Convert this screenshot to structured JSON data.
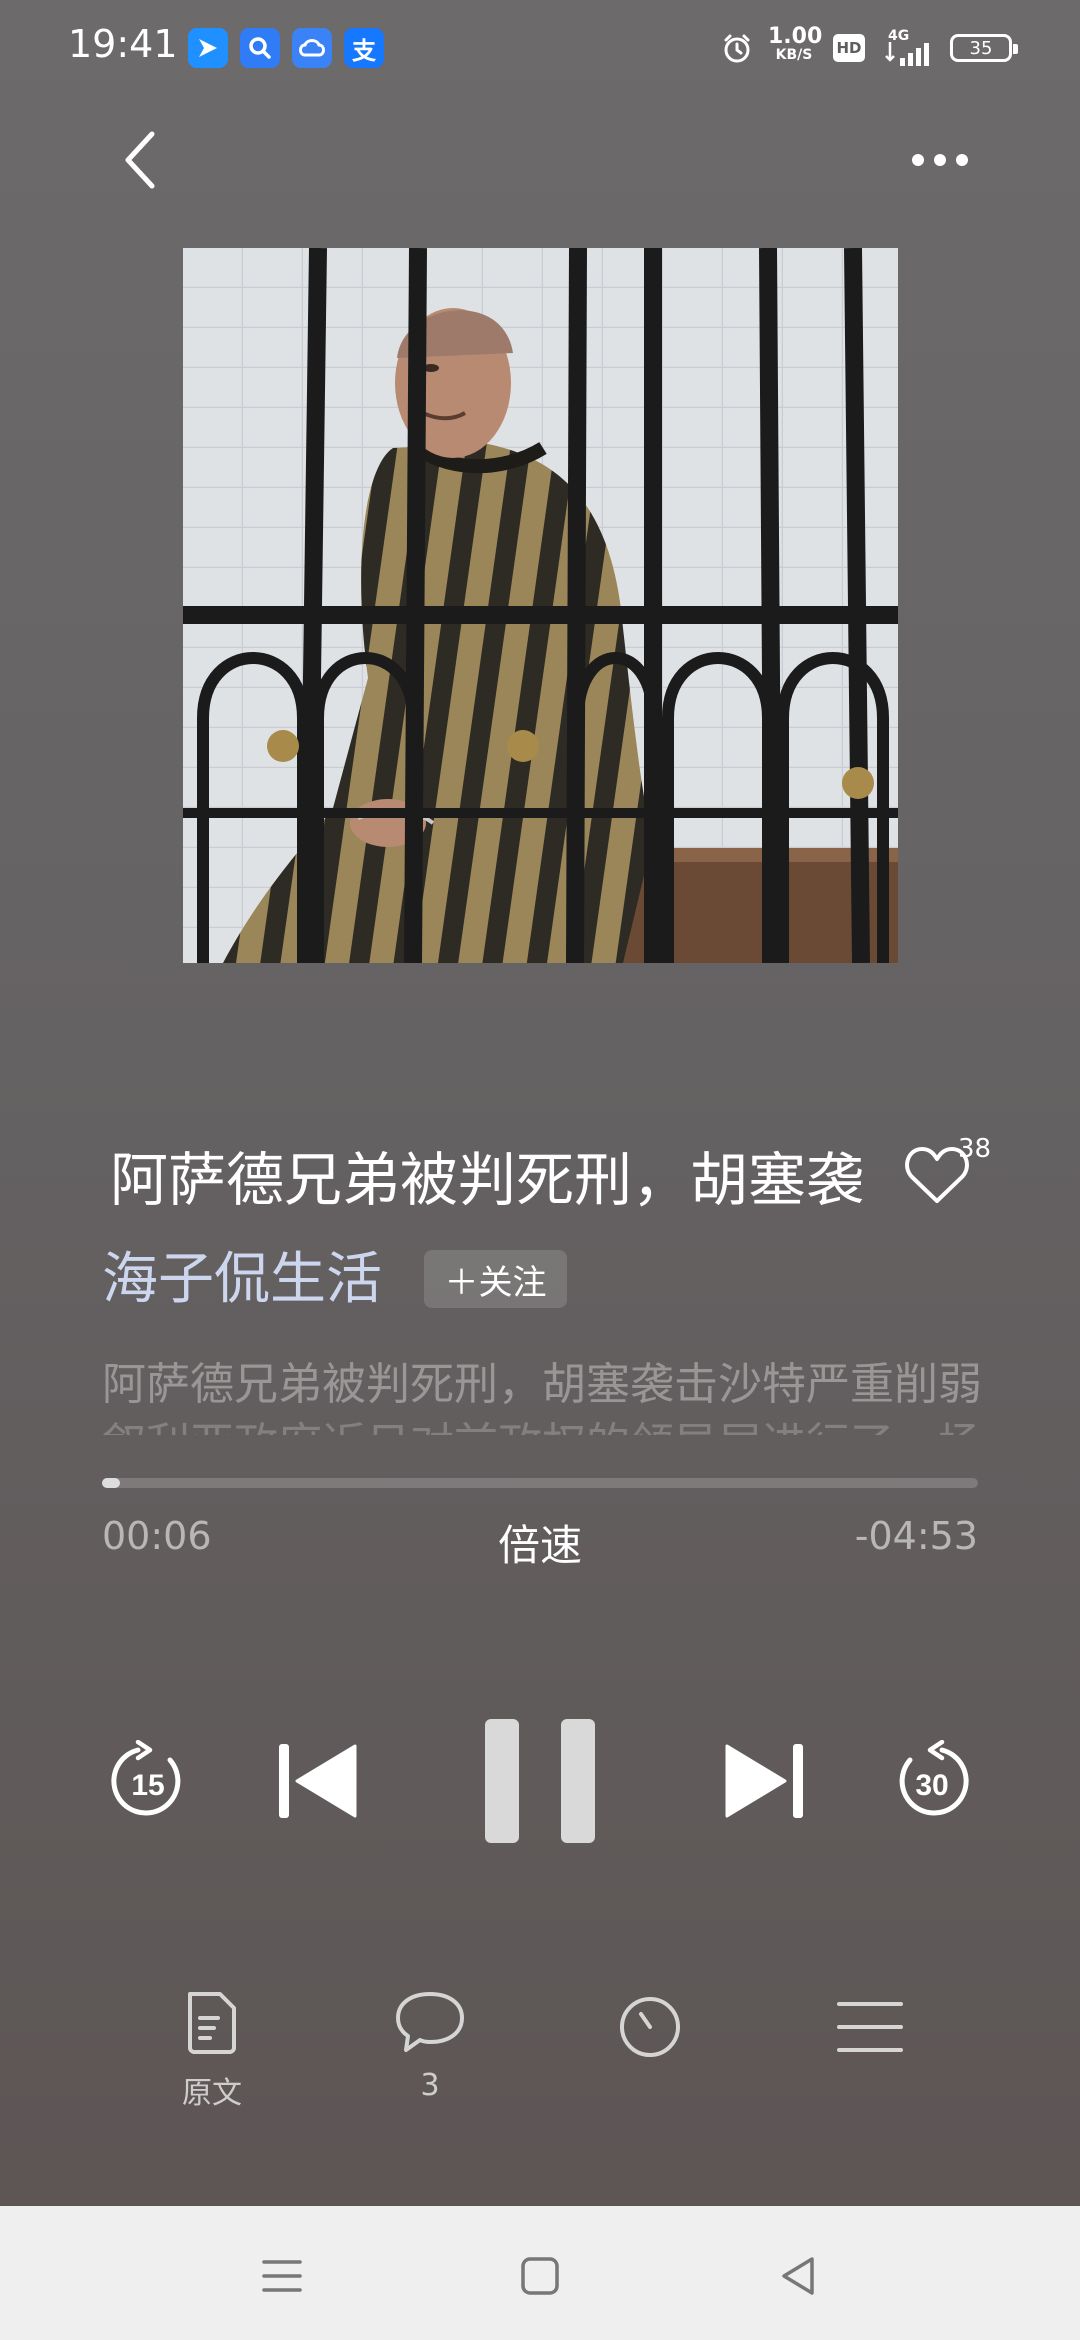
{
  "status_bar": {
    "time": "19:41",
    "app_icons": [
      {
        "name": "arrow-app-icon",
        "color": "#1e90ff",
        "glyph": "➤"
      },
      {
        "name": "search-app-icon",
        "color": "#2f7cf6",
        "glyph": "Q"
      },
      {
        "name": "cloud-app-icon",
        "color": "#3b82f6",
        "glyph": "∞"
      },
      {
        "name": "alipay-app-icon",
        "color": "#1677ff",
        "glyph": "支"
      }
    ],
    "net_speed_value": "1.00",
    "net_speed_unit": "KB/S",
    "hd_label": "HD",
    "network_label": "4G",
    "battery": "35"
  },
  "header": {
    "back_icon": "chevron-left-icon",
    "more_icon": "more-dots-icon"
  },
  "track": {
    "title": "阿萨德兄弟被判死刑，胡塞袭",
    "like_count": "38",
    "author": "海子侃生活",
    "follow_label": "＋关注",
    "summary_line1": "阿萨德兄弟被判死刑，胡塞袭击沙特严重削弱",
    "summary_line2": "叙利亚政府近日对前政权的领导层进行了一场"
  },
  "player": {
    "progress": 0.02,
    "current_time": "00:06",
    "speed_label": "倍速",
    "remaining_time": "-04:53",
    "rewind_seconds": "15",
    "forward_seconds": "30"
  },
  "bottom_bar": {
    "original_text_label": "原文",
    "comments_count": "3",
    "timer_icon": "timer-icon",
    "playlist_icon": "playlist-icon"
  },
  "colors": {
    "background_top": "#6c6a6b",
    "background_bottom": "#5c5453",
    "author_color": "#ccd6ee",
    "navbar_bg": "#efefef"
  }
}
